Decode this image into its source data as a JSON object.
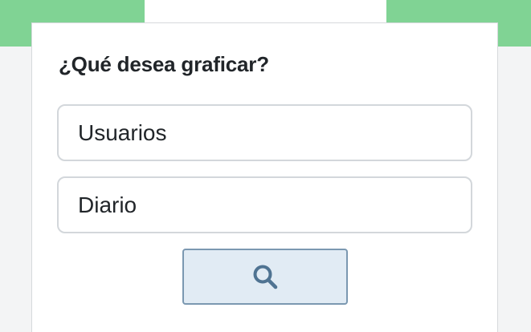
{
  "form": {
    "title": "¿Qué desea graficar?",
    "metric_select": {
      "selected": "Usuarios"
    },
    "period_select": {
      "selected": "Diario"
    },
    "search_button": {
      "icon": "search-icon"
    }
  },
  "colors": {
    "header_green": "#80d394",
    "button_bg": "#e1ebf4",
    "button_border": "#7b98b1",
    "icon_color": "#4f7392"
  }
}
